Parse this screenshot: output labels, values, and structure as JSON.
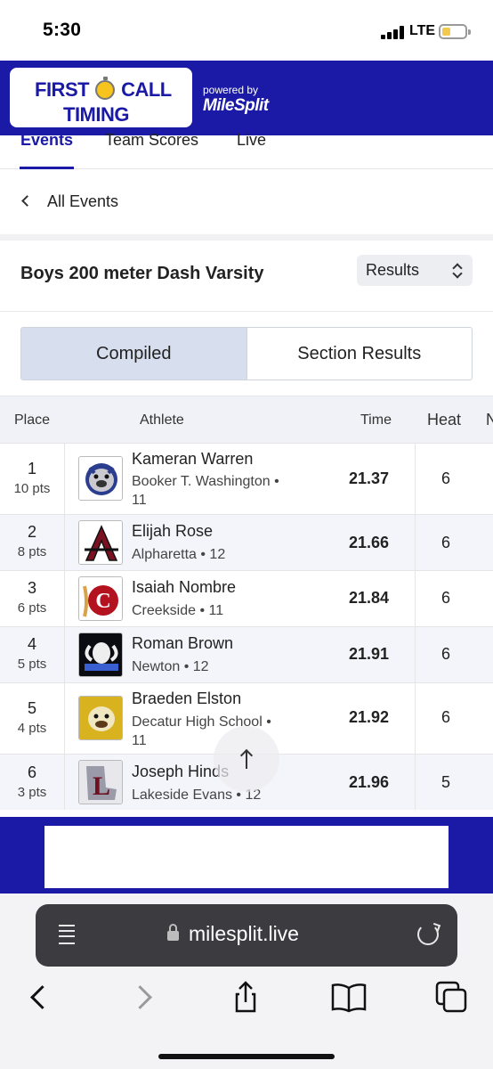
{
  "status_bar": {
    "time": "5:30",
    "network": "LTE"
  },
  "header": {
    "logo_line1_a": "FIRST",
    "logo_line1_b": "CALL",
    "logo_line2": "TIMING",
    "powered_by": "powered by",
    "brand": "MileSplit",
    "color": "#1a1aa6"
  },
  "tabs": [
    {
      "label": "Events",
      "active": true
    },
    {
      "label": "Team Scores",
      "active": false
    },
    {
      "label": "Live",
      "active": false
    }
  ],
  "back_link": {
    "label": "All Events"
  },
  "event": {
    "title": "Boys 200 meter Dash Varsity",
    "view_select": "Results"
  },
  "segmented": {
    "compiled": "Compiled",
    "section_results": "Section Results"
  },
  "table": {
    "headers": {
      "place": "Place",
      "athlete": "Athlete",
      "time": "Time",
      "heat": "Heat",
      "extra": "N"
    },
    "rows": [
      {
        "place": "1",
        "points": "10 pts",
        "name": "Kameran Warren",
        "school": "Booker T. Washington • 11",
        "time": "21.37",
        "heat": "6",
        "logo": "bulldog-logo"
      },
      {
        "place": "2",
        "points": "8 pts",
        "name": "Elijah Rose",
        "school": "Alpharetta • 12",
        "time": "21.66",
        "heat": "6",
        "logo": "letter-a-logo"
      },
      {
        "place": "3",
        "points": "6 pts",
        "name": "Isaiah Nombre",
        "school": "Creekside • 11",
        "time": "21.84",
        "heat": "6",
        "logo": "letter-c-logo"
      },
      {
        "place": "4",
        "points": "5 pts",
        "name": "Roman Brown",
        "school": "Newton • 12",
        "time": "21.91",
        "heat": "6",
        "logo": "ram-logo"
      },
      {
        "place": "5",
        "points": "4 pts",
        "name": "Braeden Elston",
        "school": "Decatur High School • 11",
        "time": "21.92",
        "heat": "6",
        "logo": "bulldog-gold-logo"
      },
      {
        "place": "6",
        "points": "3 pts",
        "name": "Joseph Hinds",
        "school": "Lakeside Evans • 12",
        "time": "21.96",
        "heat": "5",
        "logo": "letter-l-logo"
      }
    ]
  },
  "browser": {
    "url": "milesplit.live"
  }
}
